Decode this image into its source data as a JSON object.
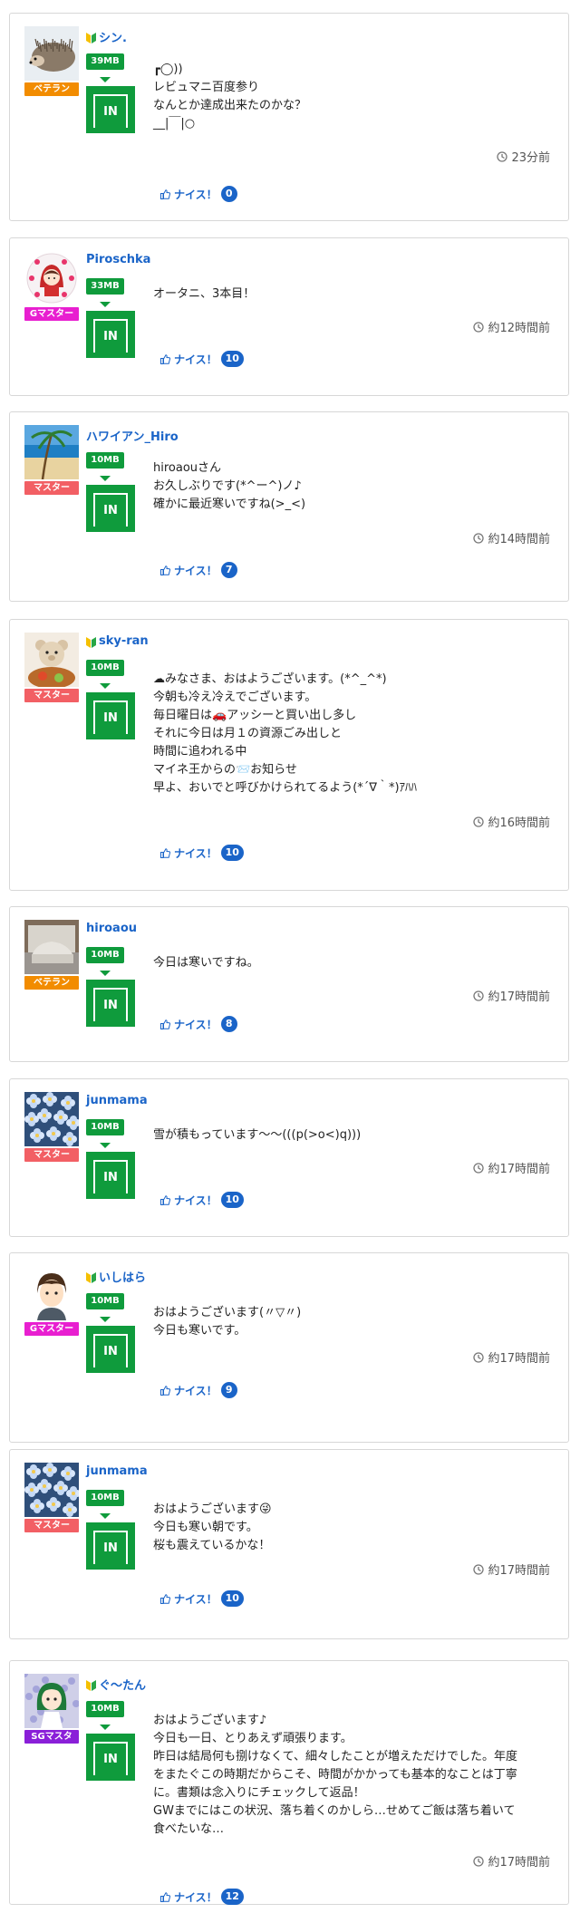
{
  "posts": [
    {
      "username": "シン.",
      "beginner": true,
      "rank": "ベテラン",
      "rank_color": "#f28c00",
      "avatar": "hedgehog",
      "mb": "39MB",
      "in_label": "IN",
      "message": [
        "┏◯))",
        "レビュマニ百度参り",
        "なんとか達成出来たのかな？",
        "__|￣|○"
      ],
      "time": "23分前",
      "like_label": "ナイス！",
      "likes": "0"
    },
    {
      "username": "Piroschka",
      "beginner": false,
      "rank": "Gマスター",
      "rank_color": "#e81fd0",
      "avatar": "doll",
      "mb": "33MB",
      "in_label": "IN",
      "message": [
        "オータニ、3本目！"
      ],
      "time": "約12時間前",
      "like_label": "ナイス！",
      "likes": "10"
    },
    {
      "username": "ハワイアン_Hiro",
      "beginner": false,
      "rank": "マスター",
      "rank_color": "#f25f64",
      "avatar": "beach",
      "mb": "10MB",
      "in_label": "IN",
      "message": [
        "hiroaouさん",
        "お久しぶりです(*^ー^)ノ♪",
        "確かに最近寒いですね(>_<)"
      ],
      "time": "約14時間前",
      "like_label": "ナイス！",
      "likes": "7"
    },
    {
      "username": "sky-ran",
      "beginner": true,
      "rank": "マスター",
      "rank_color": "#f25f64",
      "avatar": "teddy",
      "mb": "10MB",
      "in_label": "IN",
      "message": [
        "☁みなさま、おはようございます。(*^_^*)",
        "今朝も冷え冷えでございます。",
        "毎日曜日は🚗アッシーと買い出し多し",
        "それに今日は月１の資源ごみ出しと",
        "時間に追われる中",
        "マイネ王からの📨お知らせ",
        "早よ、おいでと呼びかけられてるよう(*´∇｀*)ｱﾊﾊ"
      ],
      "time": "約16時間前",
      "like_label": "ナイス！",
      "likes": "10"
    },
    {
      "username": "hiroaou",
      "beginner": false,
      "rank": "ベテラン",
      "rank_color": "#f28c00",
      "avatar": "car",
      "mb": "10MB",
      "in_label": "IN",
      "message": [
        "今日は寒いですね。"
      ],
      "time": "約17時間前",
      "like_label": "ナイス！",
      "likes": "8"
    },
    {
      "username": "junmama",
      "beginner": false,
      "rank": "マスター",
      "rank_color": "#f25f64",
      "avatar": "flowers",
      "mb": "10MB",
      "in_label": "IN",
      "message": [
        "雪が積もっています～～(((p(>o<)q)))"
      ],
      "time": "約17時間前",
      "like_label": "ナイス！",
      "likes": "10"
    },
    {
      "username": "いしはら",
      "beginner": true,
      "rank": "Gマスター",
      "rank_color": "#e81fd0",
      "avatar": "boy",
      "mb": "10MB",
      "in_label": "IN",
      "message": [
        "おはようございます(〃▽〃)",
        "今日も寒いです。"
      ],
      "time": "約17時間前",
      "like_label": "ナイス！",
      "likes": "9"
    },
    {
      "username": "junmama",
      "beginner": false,
      "rank": "マスター",
      "rank_color": "#f25f64",
      "avatar": "flowers",
      "mb": "10MB",
      "in_label": "IN",
      "message": [
        "おはようございます😜",
        "今日も寒い朝です。",
        "桜も震えているかな！"
      ],
      "time": "約17時間前",
      "like_label": "ナイス！",
      "likes": "10"
    },
    {
      "username": "ぐ～たん",
      "beginner": true,
      "rank": "SGマスタ",
      "rank_color": "#8a1fd8",
      "avatar": "girl",
      "mb": "10MB",
      "in_label": "IN",
      "message": [
        "おはようございます♪",
        "今日も一日、とりあえず頑張ります。",
        "昨日は結局何も捌けなくて、細々したことが増えただけでした。年度",
        "をまたぐこの時期だからこそ、時間がかかっても基本的なことは丁寧",
        "に。書類は念入りにチェックして返品！",
        "GWまでにはこの状況、落ち着くのかしら…せめてご飯は落ち着いて",
        "食べたいな…"
      ],
      "time": "約17時間前",
      "like_label": "ナイス！",
      "likes": "12"
    }
  ]
}
